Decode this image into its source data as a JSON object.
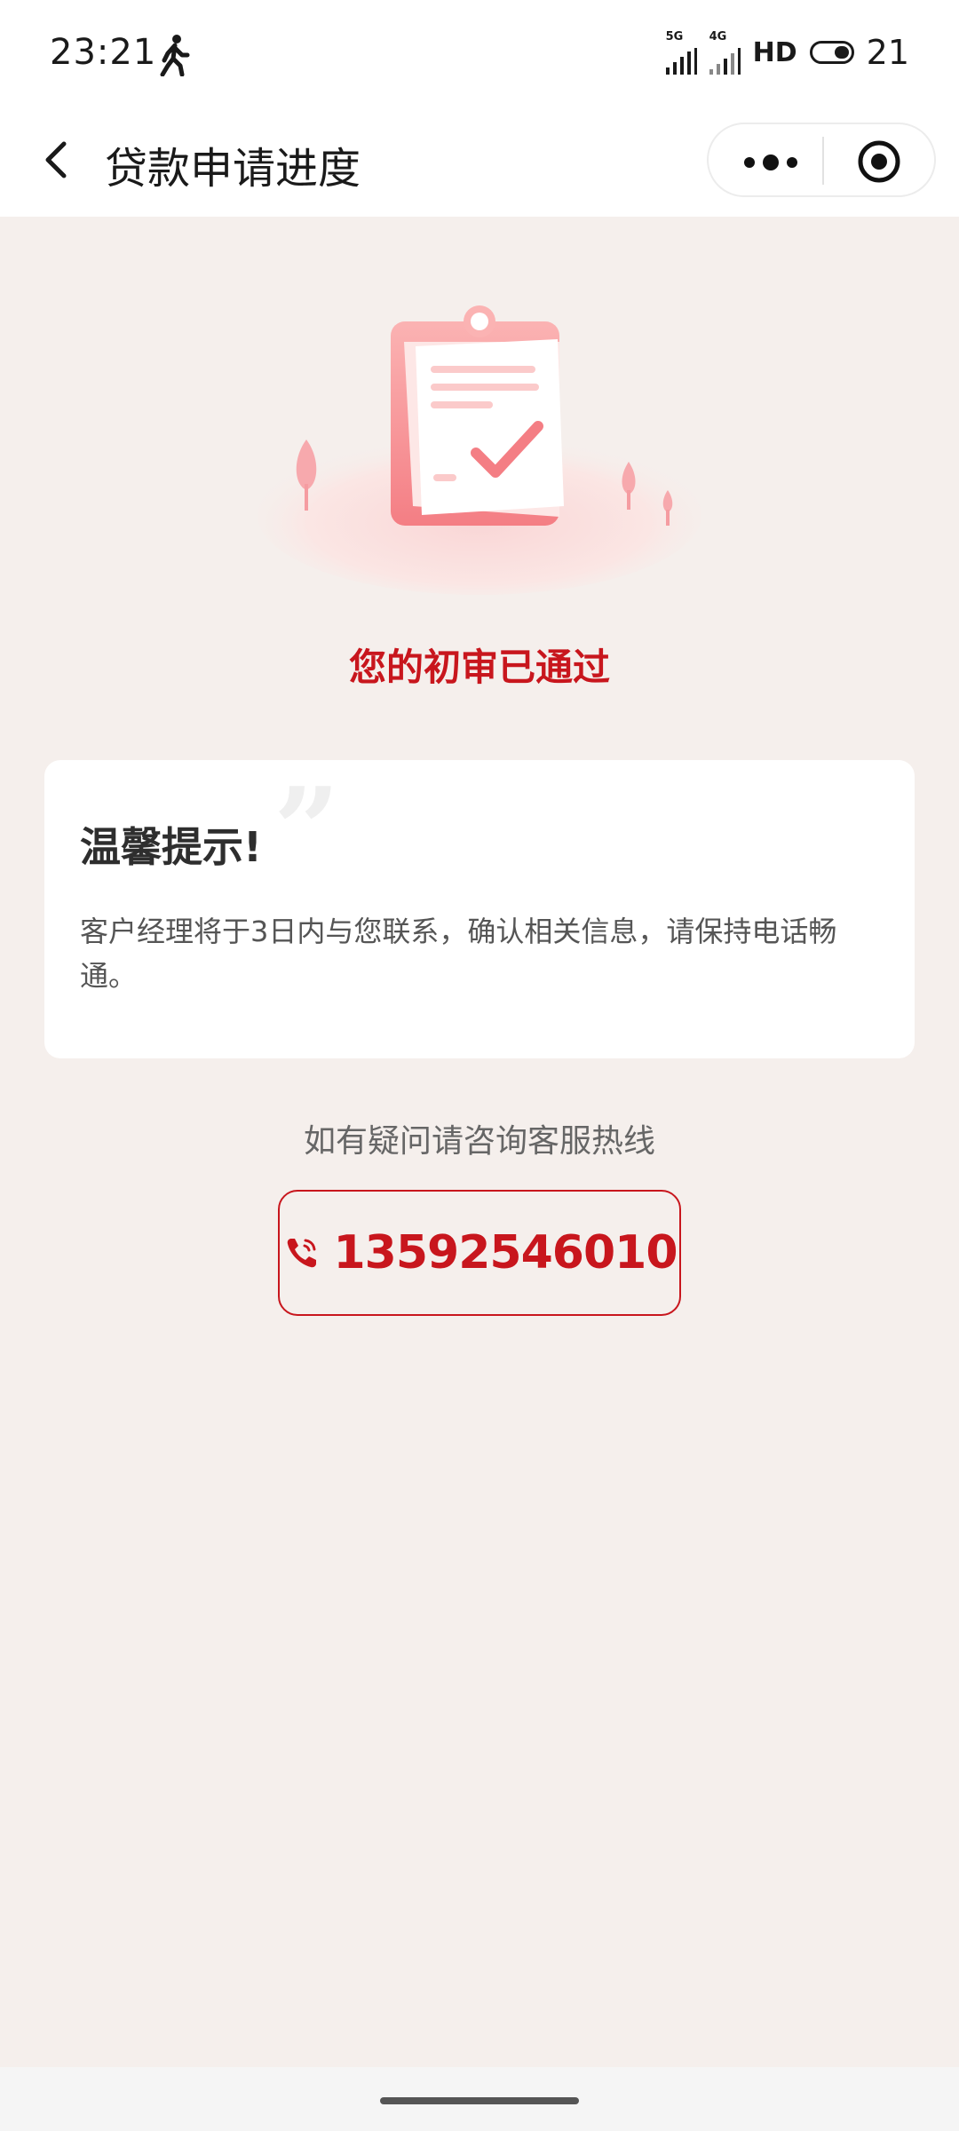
{
  "status_bar": {
    "time": "23:21",
    "network_1": "5G",
    "network_2": "4G",
    "hd_label": "HD",
    "battery": "21"
  },
  "nav": {
    "title": "贷款申请进度"
  },
  "status": {
    "approved_text": "您的初审已通过"
  },
  "notice": {
    "title": "温馨提示!",
    "quote_glyph": "”",
    "body": "客户经理将于3日内与您联系，确认相关信息，请保持电话畅通。"
  },
  "hotline": {
    "label": "如有疑问请咨询客服热线",
    "number": "13592546010"
  },
  "colors": {
    "accent": "#c8161d",
    "background": "#f5efec"
  }
}
